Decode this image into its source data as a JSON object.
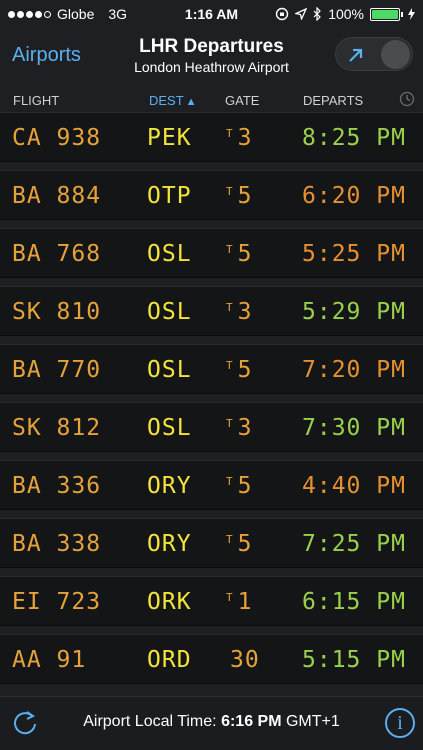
{
  "status": {
    "carrier": "Globe",
    "network": "3G",
    "time": "1:16 AM",
    "battery": "100%",
    "battery_level": 1.0,
    "icons": [
      "signal-dots-icon",
      "rotation-lock-icon",
      "location-arrow-icon",
      "bluetooth-icon",
      "battery-icon",
      "charging-bolt-icon"
    ]
  },
  "nav": {
    "back_label": "Airports",
    "title": "LHR Departures",
    "subtitle": "London Heathrow Airport",
    "toggle_icon": "arrow-up-right-icon"
  },
  "columns": {
    "flight": "FLIGHT",
    "dest": "DEST",
    "dest_sort_indicator": "▲",
    "gate": "GATE",
    "departs": "DEPARTS",
    "clock_icon": "clock-icon"
  },
  "flights": [
    {
      "flight": "CA 938",
      "dest": "PEK",
      "terminal": "T",
      "gate": "3",
      "departs": "8:25 PM",
      "status_color": "green"
    },
    {
      "flight": "BA 884",
      "dest": "OTP",
      "terminal": "T",
      "gate": "5",
      "departs": "6:20 PM",
      "status_color": "orange"
    },
    {
      "flight": "BA 768",
      "dest": "OSL",
      "terminal": "T",
      "gate": "5",
      "departs": "5:25 PM",
      "status_color": "orange"
    },
    {
      "flight": "SK 810",
      "dest": "OSL",
      "terminal": "T",
      "gate": "3",
      "departs": "5:29 PM",
      "status_color": "green"
    },
    {
      "flight": "BA 770",
      "dest": "OSL",
      "terminal": "T",
      "gate": "5",
      "departs": "7:20 PM",
      "status_color": "orange"
    },
    {
      "flight": "SK 812",
      "dest": "OSL",
      "terminal": "T",
      "gate": "3",
      "departs": "7:30 PM",
      "status_color": "green"
    },
    {
      "flight": "BA 336",
      "dest": "ORY",
      "terminal": "T",
      "gate": "5",
      "departs": "4:40 PM",
      "status_color": "orange"
    },
    {
      "flight": "BA 338",
      "dest": "ORY",
      "terminal": "T",
      "gate": "5",
      "departs": "7:25 PM",
      "status_color": "green"
    },
    {
      "flight": "EI 723",
      "dest": "ORK",
      "terminal": "T",
      "gate": "1",
      "departs": "6:15 PM",
      "status_color": "green"
    },
    {
      "flight": "AA 91",
      "dest": "ORD",
      "terminal": "",
      "gate": "30",
      "departs": "5:15 PM",
      "status_color": "green"
    }
  ],
  "footer": {
    "label": "Airport Local Time:",
    "time": "6:16 PM",
    "zone": "GMT+1",
    "refresh_icon": "refresh-icon",
    "info_icon": "info-icon",
    "info_glyph": "i"
  },
  "colors": {
    "accent": "#5ab0ef",
    "flight_text": "#e6a23a",
    "dest_text": "#f3e33a",
    "time_green": "#9ad14a",
    "time_orange": "#e6912f"
  }
}
